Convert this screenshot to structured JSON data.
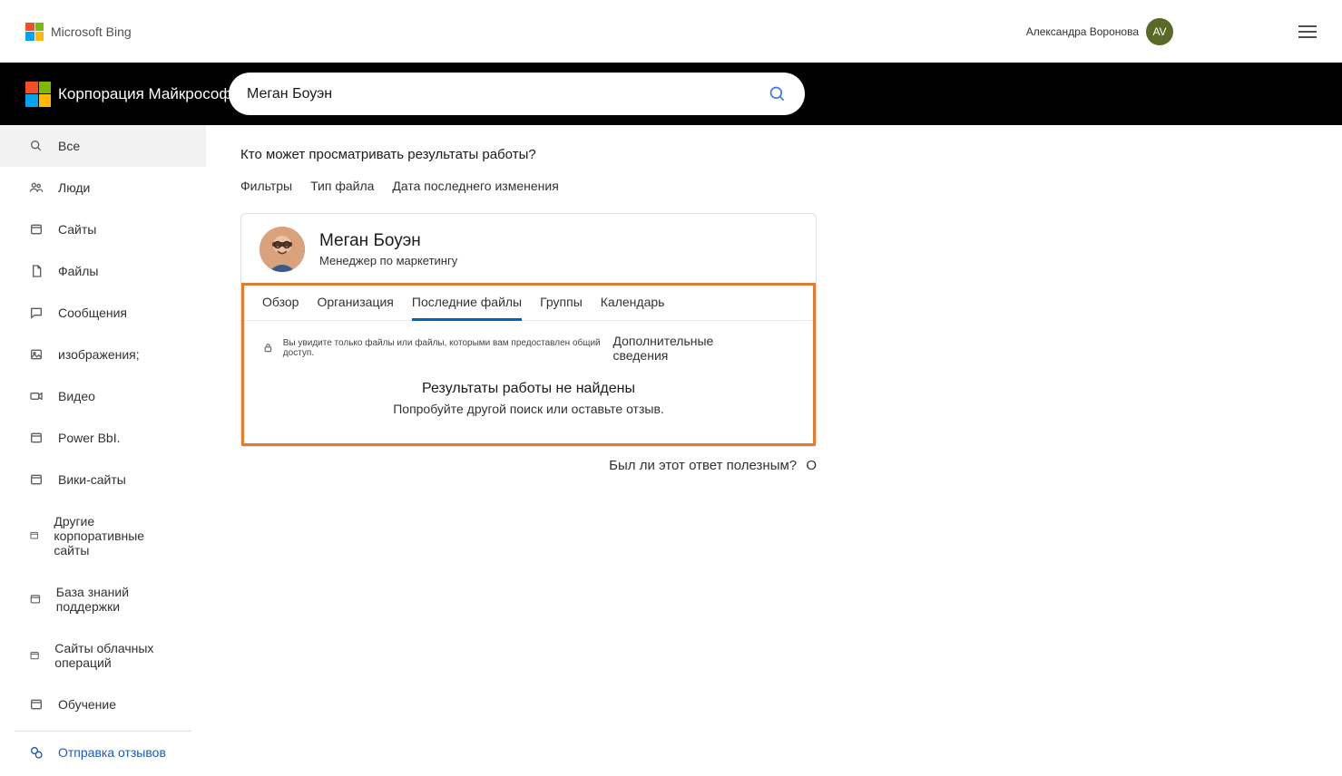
{
  "header": {
    "logo_text": "Microsoft Bing",
    "user_name": "Александра Воронова",
    "user_initials": "AV"
  },
  "search": {
    "brand_text": "Корпорация Майкрософт",
    "query": "Меган Боуэн"
  },
  "sidebar": {
    "items": [
      {
        "id": "all",
        "label": "Все",
        "iconName": "search-icon"
      },
      {
        "id": "people",
        "label": "Люди",
        "iconName": "people-icon"
      },
      {
        "id": "sites",
        "label": "Сайты",
        "iconName": "site-icon"
      },
      {
        "id": "files",
        "label": "Файлы",
        "iconName": "file-icon"
      },
      {
        "id": "messages",
        "label": "Сообщения",
        "iconName": "message-icon"
      },
      {
        "id": "images",
        "label": "изображения;",
        "iconName": "image-icon"
      },
      {
        "id": "video",
        "label": "Видео",
        "iconName": "video-icon"
      },
      {
        "id": "powerbi",
        "label": "Power BbI.",
        "iconName": "site-icon"
      },
      {
        "id": "wiki",
        "label": "Вики-сайты",
        "iconName": "site-icon"
      },
      {
        "id": "corp",
        "label": "Другие корпоративные сайты",
        "iconName": "site-icon"
      },
      {
        "id": "kb",
        "label": "База знаний поддержки",
        "iconName": "site-icon"
      },
      {
        "id": "cloud",
        "label": "Сайты облачных операций",
        "iconName": "site-icon"
      },
      {
        "id": "training",
        "label": "Обучение",
        "iconName": "site-icon"
      }
    ],
    "feedback_label": "Отправка отзывов"
  },
  "content": {
    "subheading": "Кто может просматривать результаты работы?",
    "filters_label": "Фильтры",
    "filter_file_type": "Тип файла",
    "filter_modified": "Дата последнего изменения"
  },
  "person": {
    "name": "Меган Боуэн",
    "role": "Менеджер по маркетингу",
    "tabs": [
      {
        "label": "Обзор"
      },
      {
        "label": "Организация"
      },
      {
        "label": "Последние файлы",
        "active": true
      },
      {
        "label": "Группы"
      },
      {
        "label": "Календарь"
      }
    ],
    "info_note": "Вы увидите только файлы или файлы, которыми вам предоставлен общий доступ.",
    "info_more": "Дополнительные сведения",
    "empty_title": "Результаты работы не найдены",
    "empty_sub": "Попробуйте другой поиск или оставьте отзыв."
  },
  "feedback": {
    "question": "Был ли этот ответ полезным?",
    "suffix": "О"
  }
}
